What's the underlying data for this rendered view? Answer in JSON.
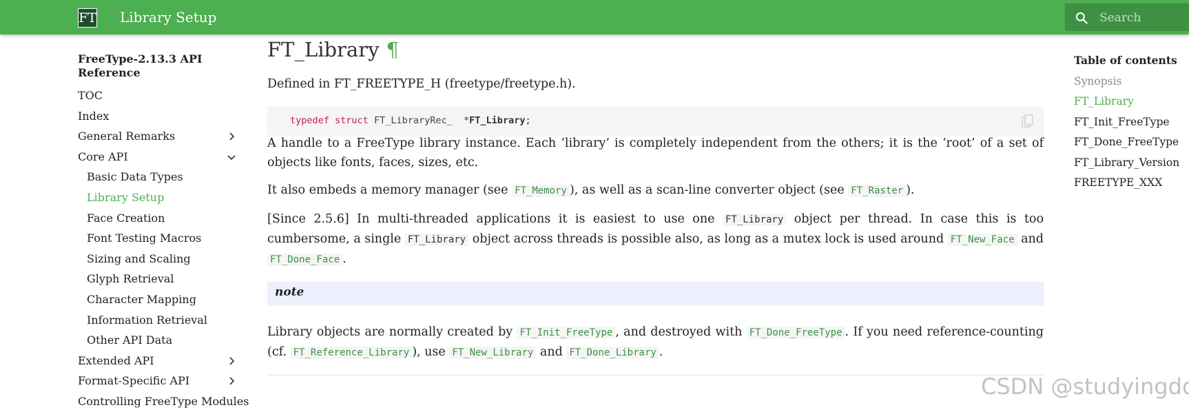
{
  "header": {
    "logo_text": "FT",
    "title": "Library Setup",
    "search_placeholder": "Search",
    "color": "#4caf50"
  },
  "sidebar": {
    "title": "FreeType-2.13.3 API Reference",
    "items": [
      {
        "label": "TOC"
      },
      {
        "label": "Index"
      },
      {
        "label": "General Remarks",
        "icon": "chevron-right-icon"
      },
      {
        "label": "Core API",
        "icon": "chevron-down-icon"
      },
      {
        "label": "Basic Data Types"
      },
      {
        "label": "Library Setup"
      },
      {
        "label": "Face Creation"
      },
      {
        "label": "Font Testing Macros"
      },
      {
        "label": "Sizing and Scaling"
      },
      {
        "label": "Glyph Retrieval"
      },
      {
        "label": "Character Mapping"
      },
      {
        "label": "Information Retrieval"
      },
      {
        "label": "Other API Data"
      },
      {
        "label": "Extended API",
        "icon": "chevron-right-icon"
      },
      {
        "label": "Format-Specific API",
        "icon": "chevron-right-icon"
      },
      {
        "label": "Controlling FreeType Modules"
      }
    ]
  },
  "main": {
    "heading": "FT_Library",
    "heading_anchor": "¶",
    "defined_in": "Defined in FT_FREETYPE_H (freetype/freetype.h).",
    "code": {
      "kw1": "typedef",
      "kw2": "struct",
      "type": "FT_LibraryRec_",
      "star": "*",
      "name": "FT_Library",
      "semi": ";",
      "copy_icon": "copy-icon"
    },
    "para1": "A handle to a FreeType library instance. Each ‘library’ is completely independent from the others; it is the ‘root’ of a set of objects like fonts, faces, sizes, etc.",
    "para2": {
      "t1": "It also embeds a memory manager (see ",
      "c1": "FT_Memory",
      "t2": "), as well as a scan-line converter object (see ",
      "c2": "FT_Raster",
      "t3": ")."
    },
    "para3": {
      "t1": "[Since 2.5.6] In multi-threaded applications it is easiest to use one ",
      "c1": "FT_Library",
      "t2": " object per thread. In case this is too cumbersome, a single ",
      "c2": "FT_Library",
      "t3": " object across threads is possible also, as long as a mutex lock is used around ",
      "c3": "FT_New_Face",
      "t4": " and ",
      "c4": "FT_Done_Face",
      "t5": "."
    },
    "note_label": "note",
    "para4": {
      "t1": "Library objects are normally created by ",
      "c1": "FT_Init_FreeType",
      "t2": ", and destroyed with ",
      "c2": "FT_Done_FreeType",
      "t3": ". If you need reference-counting (cf. ",
      "c3": "FT_Reference_Library",
      "t4": "), use ",
      "c4": "FT_New_Library",
      "t5": " and ",
      "c5": "FT_Done_Library",
      "t6": "."
    }
  },
  "toc": {
    "title": "Table of contents",
    "items": [
      {
        "label": "Synopsis"
      },
      {
        "label": "FT_Library"
      },
      {
        "label": "FT_Init_FreeType"
      },
      {
        "label": "FT_Done_FreeType"
      },
      {
        "label": "FT_Library_Version"
      },
      {
        "label": "FREETYPE_XXX"
      }
    ]
  },
  "watermark": "CSDN @studyingdda"
}
